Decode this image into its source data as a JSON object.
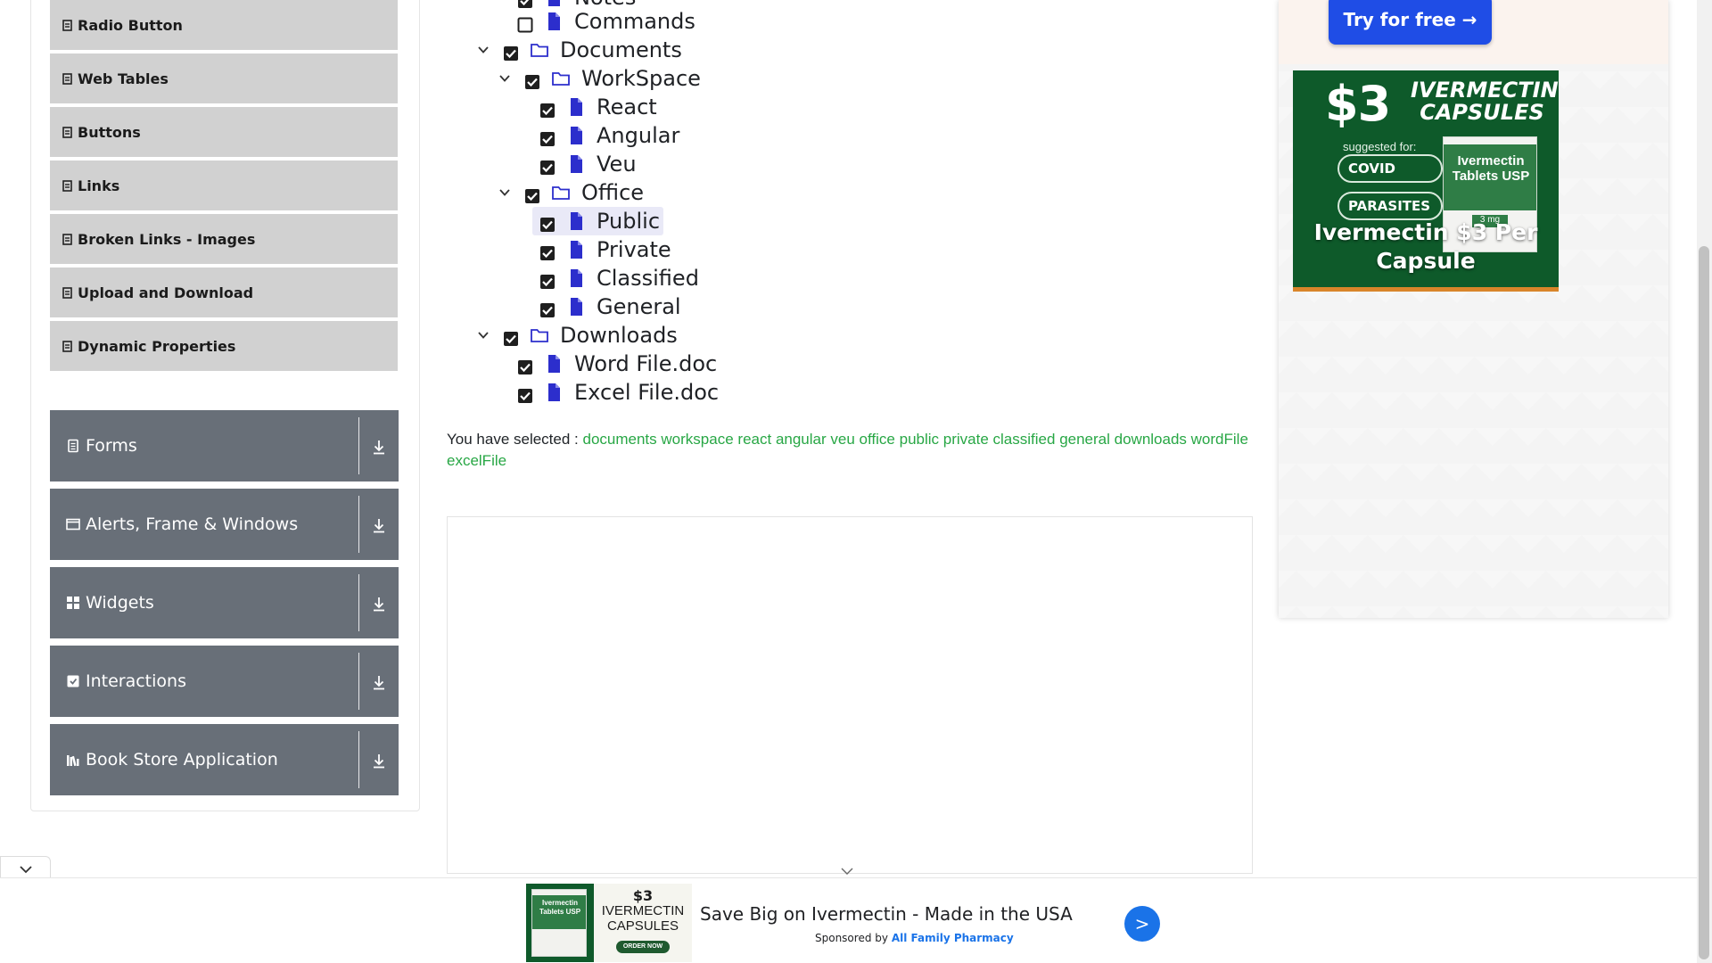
{
  "sidebar": {
    "sub_items": [
      {
        "label": "Radio Button"
      },
      {
        "label": "Web Tables"
      },
      {
        "label": "Buttons"
      },
      {
        "label": "Links"
      },
      {
        "label": "Broken Links - Images"
      },
      {
        "label": "Upload and Download"
      },
      {
        "label": "Dynamic Properties"
      }
    ],
    "groups": [
      {
        "label": "Forms",
        "icon": "form-icon"
      },
      {
        "label": "Alerts, Frame & Windows",
        "icon": "window-icon"
      },
      {
        "label": "Widgets",
        "icon": "widgets-icon"
      },
      {
        "label": "Interactions",
        "icon": "interactions-icon"
      },
      {
        "label": "Book Store Application",
        "icon": "books-icon"
      }
    ]
  },
  "tree": {
    "notes_label": "Notes",
    "commands_label": "Commands",
    "documents_label": "Documents",
    "workspace_label": "WorkSpace",
    "react_label": "React",
    "angular_label": "Angular",
    "veu_label": "Veu",
    "office_label": "Office",
    "public_label": "Public",
    "private_label": "Private",
    "classified_label": "Classified",
    "general_label": "General",
    "downloads_label": "Downloads",
    "word_label": "Word File.doc",
    "excel_label": "Excel File.doc"
  },
  "result": {
    "prefix": "You have selected :",
    "items": [
      "documents",
      "workspace",
      "react",
      "angular",
      "veu",
      "office",
      "public",
      "private",
      "classified",
      "general",
      "downloads",
      "wordFile",
      "excelFile"
    ]
  },
  "right_ad": {
    "try_label": "Try for free →",
    "price": "$3",
    "caps_line1": "IVERMECTIN",
    "caps_line2": "CAPSULES",
    "suggested": "suggested for:",
    "pill1": "COVID",
    "pill2": "PARASITES",
    "box_line1": "Ivermectin",
    "box_line2": "Tablets USP",
    "box_dose": "3 mg",
    "tagline_line1": "Ivermectin $3 Per",
    "tagline_line2": "Capsule"
  },
  "bottom_ad": {
    "img_price": "$3",
    "img_caps_line1": "IVERMECTIN",
    "img_caps_line2": "CAPSULES",
    "img_box": "Ivermectin Tablets USP",
    "img_order": "ORDER NOW",
    "headline": "Save Big on Ivermectin - Made in the USA",
    "sponsor_prefix": "Sponsored by",
    "sponsor_name": "All Family Pharmacy",
    "go_label": ">"
  },
  "colors": {
    "sidebar_sub_bg": "#d1d1d1",
    "sidebar_group_bg": "#686f78",
    "folder_icon": "#2c2ecc",
    "selected_text": "#28a745",
    "tree_highlight": "#e9e9f7"
  }
}
